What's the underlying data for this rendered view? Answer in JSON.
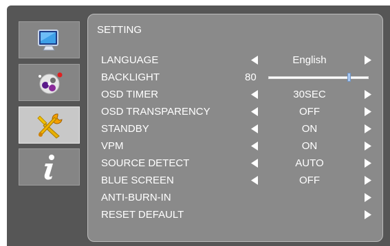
{
  "panel": {
    "title": "SETTING"
  },
  "sidebar": {
    "tabs": [
      {
        "icon": "monitor-icon",
        "active": false
      },
      {
        "icon": "color-wheel-icon",
        "active": false
      },
      {
        "icon": "wrench-screwdriver-icon",
        "active": true
      },
      {
        "icon": "info-icon",
        "active": false
      }
    ]
  },
  "settings": {
    "language": {
      "label": "LANGUAGE",
      "value": "English"
    },
    "backlight": {
      "label": "BACKLIGHT",
      "value": "80",
      "level": 0.8
    },
    "osd_timer": {
      "label": "OSD TIMER",
      "value": "30SEC"
    },
    "osd_transparency": {
      "label": "OSD TRANSPARENCY",
      "value": "OFF"
    },
    "standby": {
      "label": "STANDBY",
      "value": "ON"
    },
    "vpm": {
      "label": "VPM",
      "value": "ON"
    },
    "source_detect": {
      "label": "SOURCE DETECT",
      "value": "AUTO"
    },
    "blue_screen": {
      "label": "BLUE SCREEN",
      "value": "OFF"
    },
    "anti_burn_in": {
      "label": "ANTI-BURN-IN"
    },
    "reset_default": {
      "label": "RESET DEFAULT"
    }
  },
  "colors": {
    "frame": "#565656",
    "panel": "#8a8a8a",
    "text": "#ffffff",
    "slider_thumb": "#a9c8f0"
  }
}
